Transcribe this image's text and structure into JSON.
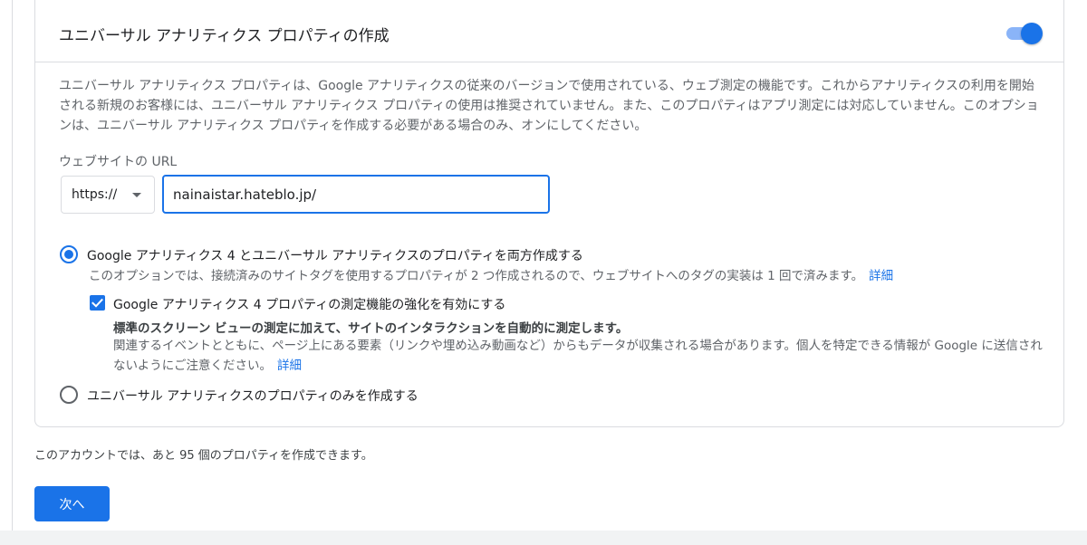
{
  "card": {
    "title": "ユニバーサル アナリティクス プロパティの作成",
    "toggle_on": true,
    "description": "ユニバーサル アナリティクス プロパティは、Google アナリティクスの従来のバージョンで使用されている、ウェブ測定の機能です。これからアナリティクスの利用を開始される新規のお客様には、ユニバーサル アナリティクス プロパティの使用は推奨されていません。また、このプロパティはアプリ測定には対応していません。このオプションは、ユニバーサル アナリティクス プロパティを作成する必要がある場合のみ、オンにしてください。"
  },
  "url_form": {
    "label": "ウェブサイトの URL",
    "protocol": "https://",
    "value": "nainaistar.hateblo.jp/"
  },
  "options": {
    "both": {
      "label": "Google アナリティクス 4 とユニバーサル アナリティクスのプロパティを両方作成する",
      "help": "このオプションでは、接続済みのサイトタグを使用するプロパティが 2 つ作成されるので、ウェブサイトへのタグの実装は 1 回で済みます。",
      "link": "詳細",
      "selected": true
    },
    "enhanced": {
      "label": "Google アナリティクス 4 プロパティの測定機能の強化を有効にする",
      "bold": "標準のスクリーン ビューの測定に加えて、サイトのインタラクションを自動的に測定します。",
      "desc": "関連するイベントとともに、ページ上にある要素（リンクや埋め込み動画など）からもデータが収集される場合があります。個人を特定できる情報が Google に送信されないようにご注意ください。",
      "link": "詳細",
      "checked": true
    },
    "ua_only": {
      "label": "ユニバーサル アナリティクスのプロパティのみを作成する",
      "selected": false
    }
  },
  "footer": {
    "remaining_text": "このアカウントでは、あと 95 個のプロパティを作成できます。",
    "next_label": "次へ"
  },
  "colors": {
    "accent": "#1a73e8",
    "border": "#dadce0",
    "text_secondary": "#5f6368"
  }
}
